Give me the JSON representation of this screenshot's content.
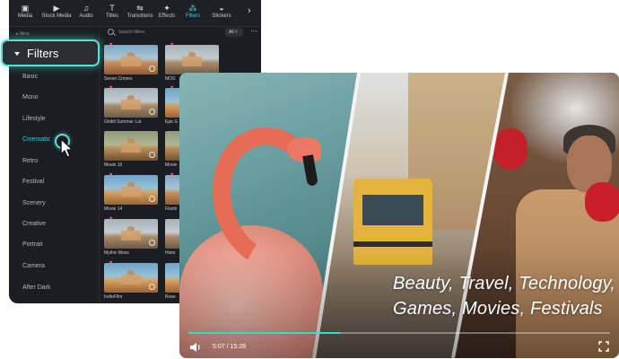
{
  "toolbar": {
    "tabs": [
      {
        "label": "Media",
        "icon": "media-icon",
        "glyph": "▣"
      },
      {
        "label": "Stock Media",
        "icon": "stock-media-icon",
        "glyph": "▶"
      },
      {
        "label": "Audio",
        "icon": "audio-icon",
        "glyph": "♫"
      },
      {
        "label": "Titles",
        "icon": "titles-icon",
        "glyph": "T"
      },
      {
        "label": "Transitions",
        "icon": "transitions-icon",
        "glyph": "⇋"
      },
      {
        "label": "Effects",
        "icon": "effects-icon",
        "glyph": "✦"
      },
      {
        "label": "Filters",
        "icon": "filters-icon",
        "glyph": "⁂"
      },
      {
        "label": "Stickers",
        "icon": "stickers-icon",
        "glyph": "◒"
      }
    ],
    "active_tab": "Filters",
    "next_glyph": "›"
  },
  "sidebar": {
    "mine_label": "Mine",
    "filters_label": "Filters",
    "categories": [
      "Basic",
      "Mono",
      "Lifestyle",
      "Cinematic",
      "Retro",
      "Festival",
      "Scenery",
      "Creative",
      "Portrait",
      "Camera",
      "After Dark"
    ],
    "active_category": "Cinematic"
  },
  "search": {
    "placeholder": "Search filters",
    "dropdown_value": "All",
    "more_glyph": "⋯"
  },
  "filters_grid": {
    "col1": [
      "Seven Crimes",
      "Ghibli Summer Lut",
      "Movie 16",
      "Movie 14",
      "Mythic Moss",
      "IndieFilm"
    ],
    "col2": [
      "MOS",
      "Epic E",
      "Movie",
      "Flashi",
      "Histo",
      "Rose"
    ]
  },
  "video": {
    "caption_line1": "Beauty, Travel, Technology,",
    "caption_line2": "Games, Movies, Festivals",
    "time": "5:07 / 15:28",
    "progress": 0.36
  },
  "colors": {
    "accent": "#33d0e0",
    "highlight": "#59e0d6",
    "progress": "#3dd6c9",
    "heart": "#ff4f9a"
  }
}
